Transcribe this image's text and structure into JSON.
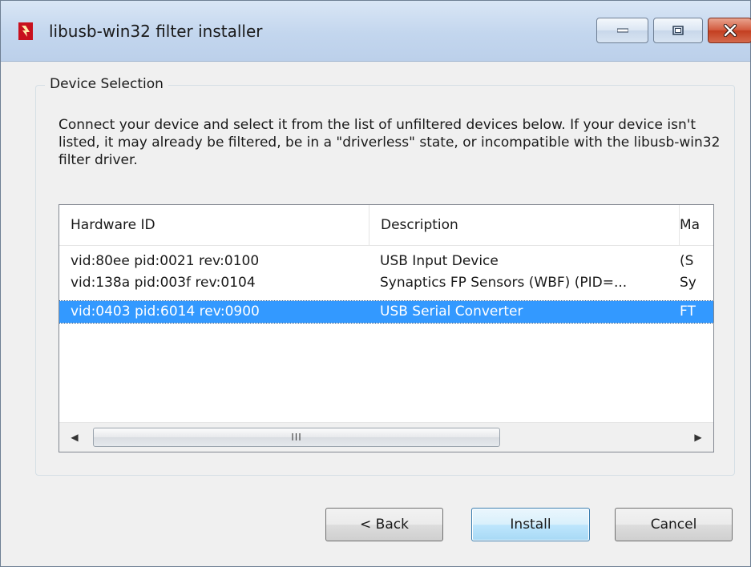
{
  "window": {
    "title": "libusb-win32 filter installer",
    "icon": "libusb-app-icon",
    "controls": [
      "minimize-icon",
      "maximize-icon",
      "close-icon"
    ]
  },
  "device_selection": {
    "group_label": "Device Selection",
    "instructions": "Connect your device and select it from the list of unfiltered devices below. If your device isn't listed, it may already be filtered, be in a \"driverless\" state, or incompatible with the libusb-win32 filter driver."
  },
  "device_list": {
    "columns": [
      "Hardware ID",
      "Description",
      "Ma"
    ],
    "rows": [
      {
        "hardware_id": "vid:80ee pid:0021 rev:0100",
        "description": "USB Input Device",
        "manufacturer": "(S",
        "selected": false
      },
      {
        "hardware_id": "vid:138a pid:003f rev:0104",
        "description": "Synaptics FP Sensors (WBF) (PID=...",
        "manufacturer": "Sy",
        "selected": false
      },
      {
        "hardware_id": "vid:0403 pid:6014 rev:0900",
        "description": "USB Serial Converter",
        "manufacturer": "FT",
        "selected": true
      }
    ],
    "scrollbar_grip": "III"
  },
  "buttons": {
    "back": "< Back",
    "install": "Install",
    "cancel": "Cancel"
  },
  "colors": {
    "selection": "#3399ff",
    "window_bg": "#f0f0f0",
    "close_button": "#c33d1f"
  }
}
